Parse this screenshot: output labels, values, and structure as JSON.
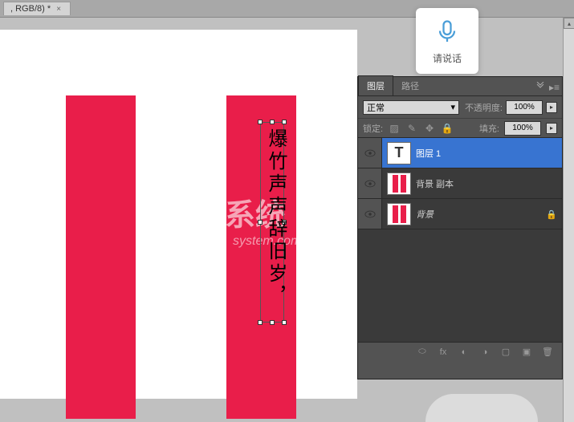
{
  "tab": {
    "title": ", RGB/8) *",
    "close": "×"
  },
  "voice": {
    "prompt": "请说话"
  },
  "canvas": {
    "text_content": "爆竹声声辞旧岁，"
  },
  "watermark": {
    "main": "系统",
    "sub": "system.com"
  },
  "panel": {
    "tabs": {
      "layers": "图层",
      "paths": "路径"
    },
    "blend_mode": "正常",
    "opacity_label": "不透明度:",
    "opacity_value": "100%",
    "lock_label": "锁定:",
    "fill_label": "填充:",
    "fill_value": "100%"
  },
  "layers": [
    {
      "name": "图层 1",
      "thumb_type": "T",
      "selected": true,
      "locked": false
    },
    {
      "name": "背景 副本",
      "thumb_type": "couplet",
      "selected": false,
      "locked": false
    },
    {
      "name": "背景",
      "thumb_type": "couplet",
      "selected": false,
      "locked": true,
      "italic": true
    }
  ],
  "footer_icons": [
    "link",
    "fx",
    "mask",
    "adjust",
    "folder",
    "new",
    "trash"
  ]
}
